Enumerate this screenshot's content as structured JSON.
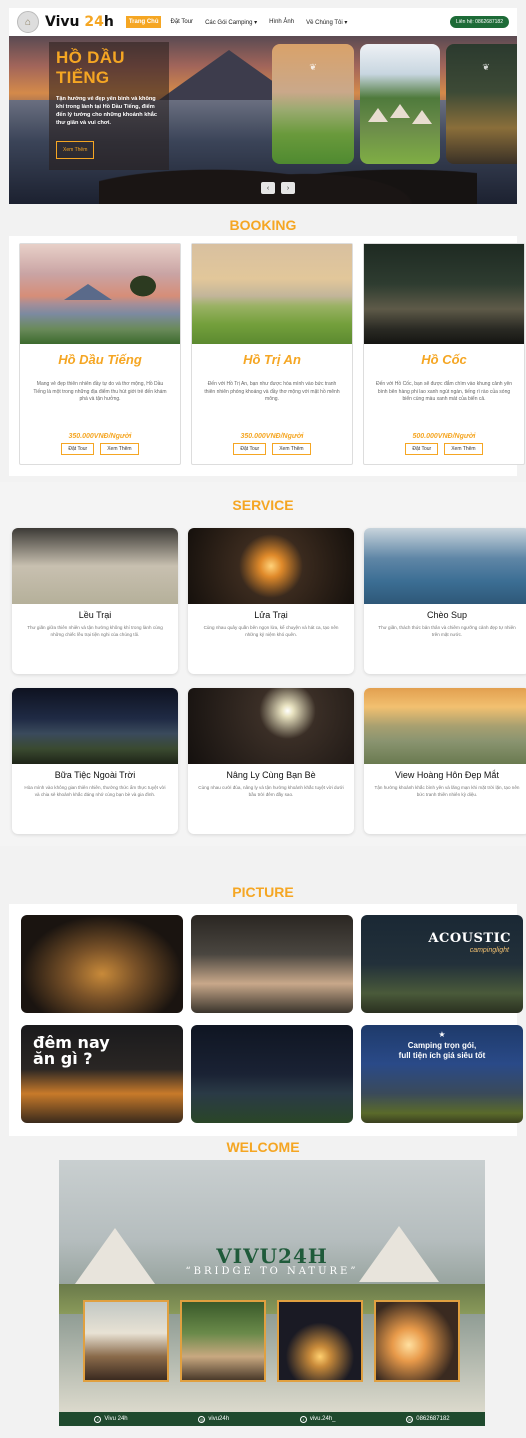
{
  "nav": {
    "logo_text": "Vivu ",
    "logo_accent": "24",
    "logo_suffix": "h",
    "items": [
      {
        "label": "Trang Chủ"
      },
      {
        "label": "Đặt Tour"
      },
      {
        "label": "Các Gói Camping ▾"
      },
      {
        "label": "Hình Ảnh"
      },
      {
        "label": "Về Chúng Tôi ▾"
      }
    ],
    "contact_label": "Liên hệ: 0862687182"
  },
  "hero": {
    "title_line1": "HỒ DẦU",
    "title_line2": "TIẾNG",
    "description": "Tận hưởng vẻ đẹp yên bình và không khí trong lành tại Hồ Dầu Tiếng, điểm đến lý tưởng cho những khoảnh khắc thư giãn và vui chơi.",
    "button_label": "Xem Thêm",
    "prev_label": "‹",
    "next_label": "›"
  },
  "booking": {
    "title": "BOOKING",
    "cards": [
      {
        "name": "Hồ Dầu Tiếng",
        "description": "Mang vẻ đẹp thiên nhiên đầy tự do và thơ mộng, Hồ Dầu Tiếng là một trong những địa điểm thu hút giới trẻ đến khám phá và tận hưởng.",
        "price": "350.000VNĐ/Người",
        "book_label": "Đặt Tour",
        "more_label": "Xem Thêm"
      },
      {
        "name": "Hồ Trị An",
        "description": "Đến với Hồ Trị An, bạn như được hòa mình vào bức tranh thiên nhiên phóng khoáng và đầy thơ mộng với mặt hồ mênh mông.",
        "price": "350.000VNĐ/Người",
        "book_label": "Đặt Tour",
        "more_label": "Xem Thêm"
      },
      {
        "name": "Hồ Cốc",
        "description": "Đến với Hồ Cốc, bạn sẽ được đắm chìm vào khung cảnh yên bình bên hàng phi lao xanh ngút ngàn, tiếng rì rào của sóng biển cùng màu xanh mát của biển cả.",
        "price": "500.000VNĐ/Người",
        "book_label": "Đặt Tour",
        "more_label": "Xem Thêm"
      }
    ]
  },
  "service": {
    "title": "SERVICE",
    "cards": [
      {
        "name": "Lều Trại",
        "description": "Thư giãn giữa thiên nhiên và tận hưởng không khí trong lành cùng những chiếc lều trại tiện nghi của chúng tôi."
      },
      {
        "name": "Lửa Trại",
        "description": "Cùng nhau quây quần bên ngọn lửa, kể chuyện và hát ca, tạo nên những kỷ niệm khó quên."
      },
      {
        "name": "Chèo Sup",
        "description": "Thư giãn, thách thức bản thân và chiêm ngưỡng cảnh đẹp tự nhiên trên mặt nước."
      },
      {
        "name": "Bữa Tiệc Ngoài Trời",
        "description": "Hòa mình vào không gian thiên nhiên, thưởng thức ẩm thực tuyệt vời và chia sẻ khoảnh khắc đáng nhớ cùng bạn bè và gia đình."
      },
      {
        "name": "Nâng Ly Cùng Bạn Bè",
        "description": "Cùng nhau cười đùa, nâng ly và tận hưởng khoảnh khắc tuyệt vời dưới bầu trời đêm đầy sao."
      },
      {
        "name": "View Hoàng Hôn Đẹp Mắt",
        "description": "Tận hưởng khoảnh khắc bình yên và lãng mạn khi mặt trời lặn, tạo nên bức tranh thiên nhiên kỳ diệu."
      }
    ]
  },
  "picture": {
    "title": "PICTURE",
    "acoustic": "ACOUSTIC",
    "acoustic_sub": "campinglight",
    "demnay_line1": "đêm nay",
    "demnay_line2": "ăn gì ?",
    "camping_line1": "Camping trọn gói,",
    "camping_line2": "full tiện ích giá siêu tốt"
  },
  "welcome": {
    "title": "WELCOME",
    "brand": "VIVU24H",
    "tagline": "“BRIDGE TO NATURE”",
    "footer": [
      {
        "icon": "f",
        "label": "Vivu 24h"
      },
      {
        "icon": "◎",
        "label": "vivu24h"
      },
      {
        "icon": "♪",
        "label": "vivu.24h_"
      },
      {
        "icon": "☏",
        "label": "0862687182"
      }
    ]
  }
}
